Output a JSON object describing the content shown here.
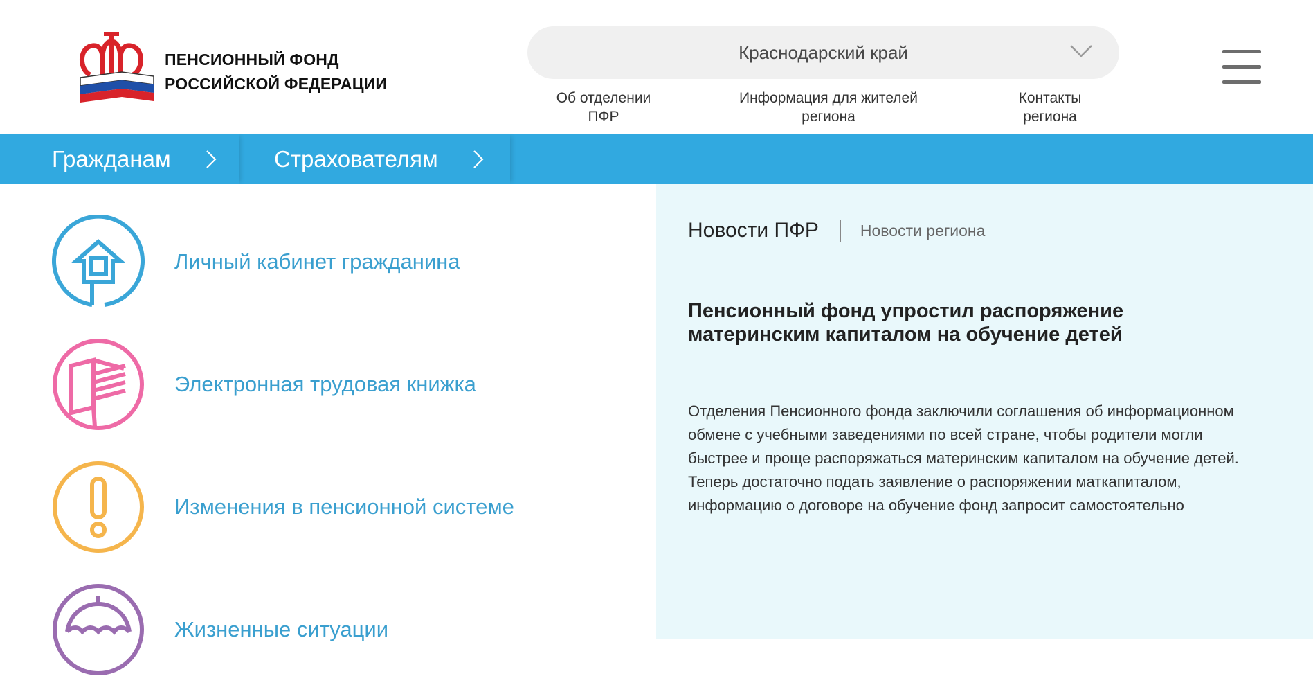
{
  "header": {
    "logo_line1": "ПЕНСИОННЫЙ ФОНД",
    "logo_line2": "РОССИЙСКОЙ ФЕДЕРАЦИИ",
    "region": "Краснодарский край",
    "links": [
      {
        "line1": "Об отделении",
        "line2": "ПФР"
      },
      {
        "line1": "Информация для жителей",
        "line2": "региона"
      },
      {
        "line1": "Контакты",
        "line2": "региона"
      }
    ]
  },
  "nav": {
    "items": [
      "Гражданам",
      "Страхователям"
    ]
  },
  "services": [
    {
      "label": "Личный кабинет гражданина",
      "icon": "house-icon",
      "color": "#3aa6d8"
    },
    {
      "label": "Электронная трудовая книжка",
      "icon": "book-icon",
      "color": "#ee6aa6"
    },
    {
      "label": "Изменения в пенсионной системе",
      "icon": "exclamation-icon",
      "color": "#f5b54c"
    },
    {
      "label": "Жизненные ситуации",
      "icon": "umbrella-icon",
      "color": "#9a6cb0"
    }
  ],
  "news": {
    "tab_active": "Новости ПФР",
    "tab_inactive": "Новости региона",
    "title": "Пенсионный фонд упростил распоряжение материнским капиталом на обучение детей",
    "body": "Отделения Пенсионного фонда заключили соглашения об информационном обмене с учебными заведениями по всей стране, чтобы родители могли быстрее и проще распоряжаться материнским капиталом на обучение детей. Теперь достаточно подать заявление о распоряжении маткапиталом, информацию о договоре на обучение фонд запросит самостоятельно"
  },
  "colors": {
    "nav_blue": "#31a9e0",
    "link_blue": "#3a9fcf",
    "news_bg": "#e9f8fb",
    "logo_red": "#d8232a"
  }
}
